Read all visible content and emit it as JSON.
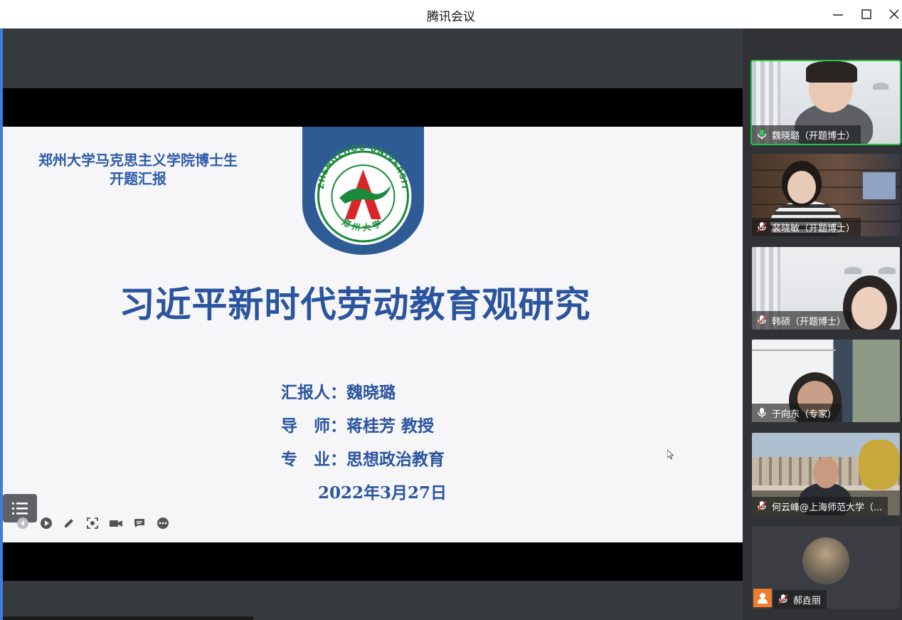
{
  "app": {
    "title": "腾讯会议"
  },
  "window_controls": {
    "minimize": "—",
    "maximize": "☐",
    "close": "✕"
  },
  "slide": {
    "header_line1": "郑州大学马克思主义学院博士生",
    "header_line2": "开题汇报",
    "logo_text": "ZHENGZHOU UNIVERSITY",
    "logo_text_bottom": "郑 州 大 学",
    "title": "习近平新时代劳动教育观研究",
    "reporter": "汇报人：魏晓璐",
    "advisor": "导　师：蒋桂芳 教授",
    "major": "专　业：思想政治教育",
    "date": "2022年3月27日"
  },
  "presentation_toolbar": {
    "menu_icon": "list-icon",
    "items": [
      "back-icon",
      "play-icon",
      "pencil-icon",
      "screenshot-icon",
      "camera-icon",
      "comment-icon",
      "more-icon"
    ]
  },
  "participants": [
    {
      "name": "魏晓璐（开题博士）",
      "mic": "on",
      "active": true
    },
    {
      "name": "裴晓敏（开题博士）",
      "mic": "muted",
      "active": false
    },
    {
      "name": "韩硕（开题博士）",
      "mic": "muted",
      "active": false
    },
    {
      "name": "于向东（专家）",
      "mic": "on",
      "active": false
    },
    {
      "name": "何云峰@上海师范大学（...",
      "mic": "muted",
      "active": false
    },
    {
      "name": "郝垚丽",
      "mic": "muted",
      "active": false,
      "video": "off"
    }
  ],
  "colors": {
    "slide_blue": "#2a549e",
    "active_border": "#26c24b",
    "badge_blue": "#2f5b95",
    "logo_red": "#d8262a",
    "logo_green": "#1a8a3a"
  }
}
